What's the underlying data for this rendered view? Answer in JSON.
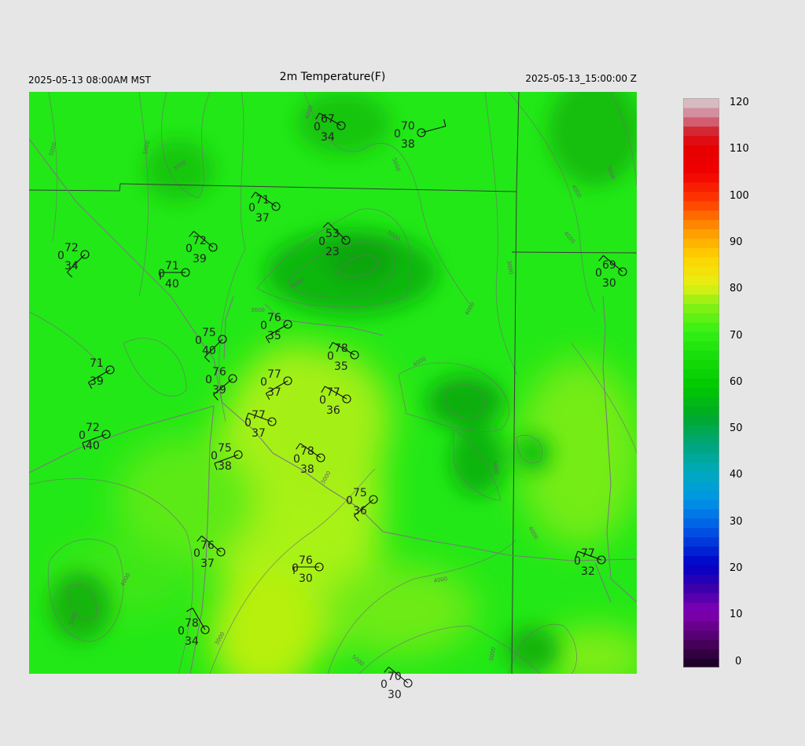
{
  "header": {
    "left": "2025-05-13 08:00AM MST",
    "title": "2m Temperature(F)",
    "right": "2025-05-13_15:00:00 Z"
  },
  "colorbar": {
    "ticks": [
      "120",
      "110",
      "100",
      "90",
      "80",
      "70",
      "60",
      "50",
      "40",
      "30",
      "20",
      "10",
      "0"
    ]
  },
  "contour_labels": [
    "5000",
    "5000",
    "4000",
    "5000",
    "5000",
    "5000",
    "6000",
    "4000",
    "3000",
    "3000",
    "4000",
    "4000",
    "4000",
    "5000",
    "5000",
    "3000",
    "4000",
    "5000",
    "3000",
    "4000",
    "5000",
    "5000",
    "4000"
  ],
  "stations": [
    {
      "t": "67",
      "s": "0",
      "d": "34"
    },
    {
      "t": "70",
      "s": "0",
      "d": "38"
    },
    {
      "t": "71",
      "s": "0",
      "d": "37"
    },
    {
      "t": "53",
      "s": "0",
      "d": "23"
    },
    {
      "t": "72",
      "s": "0",
      "d": "34"
    },
    {
      "t": "72",
      "s": "0",
      "d": "39"
    },
    {
      "t": "71",
      "s": "0",
      "d": "40"
    },
    {
      "t": "69",
      "s": "0",
      "d": "30"
    },
    {
      "t": "76",
      "s": "0",
      "d": "35"
    },
    {
      "t": "75",
      "s": "0",
      "d": "40"
    },
    {
      "t": "78",
      "s": "0",
      "d": "35"
    },
    {
      "t": "71",
      "s": "",
      "d": "39"
    },
    {
      "t": "76",
      "s": "0",
      "d": "39"
    },
    {
      "t": "77",
      "s": "0",
      "d": "37"
    },
    {
      "t": "77",
      "s": "0",
      "d": "36"
    },
    {
      "t": "72",
      "s": "0",
      "d": "40"
    },
    {
      "t": "77",
      "s": "0",
      "d": "37"
    },
    {
      "t": "75",
      "s": "0",
      "d": "38"
    },
    {
      "t": "78",
      "s": "0",
      "d": "38"
    },
    {
      "t": "75",
      "s": "0",
      "d": "36"
    },
    {
      "t": "76",
      "s": "0",
      "d": "37"
    },
    {
      "t": "77",
      "s": "0",
      "d": "32"
    },
    {
      "t": "76",
      "s": "0",
      "d": "30"
    },
    {
      "t": "78",
      "s": "0",
      "d": "34"
    },
    {
      "t": "70",
      "s": "0",
      "d": "30"
    }
  ]
}
